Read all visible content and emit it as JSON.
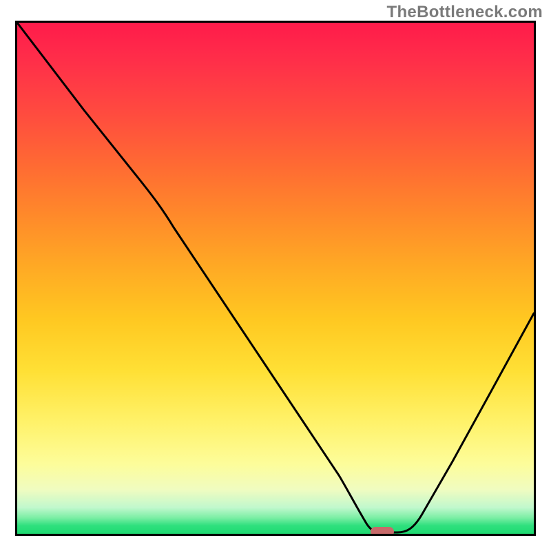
{
  "watermark": "TheBottleneck.com",
  "chart_data": {
    "type": "line",
    "title": "",
    "xlabel": "",
    "ylabel": "",
    "xlim": [
      0,
      100
    ],
    "ylim": [
      0,
      100
    ],
    "x": [
      0,
      8,
      16,
      24,
      30,
      38,
      46,
      54,
      60,
      64,
      67,
      70,
      74,
      78,
      84,
      90,
      96,
      100
    ],
    "values": [
      100,
      88,
      76,
      64,
      55,
      43,
      31,
      19,
      10,
      5,
      2,
      1,
      1,
      3,
      12,
      25,
      40,
      50
    ],
    "gradient_background": {
      "top": "#ff1a4b",
      "bottom": "#1ad96e",
      "note": "vertical red-to-green spectrum"
    },
    "marker": {
      "x": 70,
      "y": 1,
      "shape": "rounded-rect",
      "color": "#c76a6a"
    },
    "grid": false,
    "legend": false
  }
}
